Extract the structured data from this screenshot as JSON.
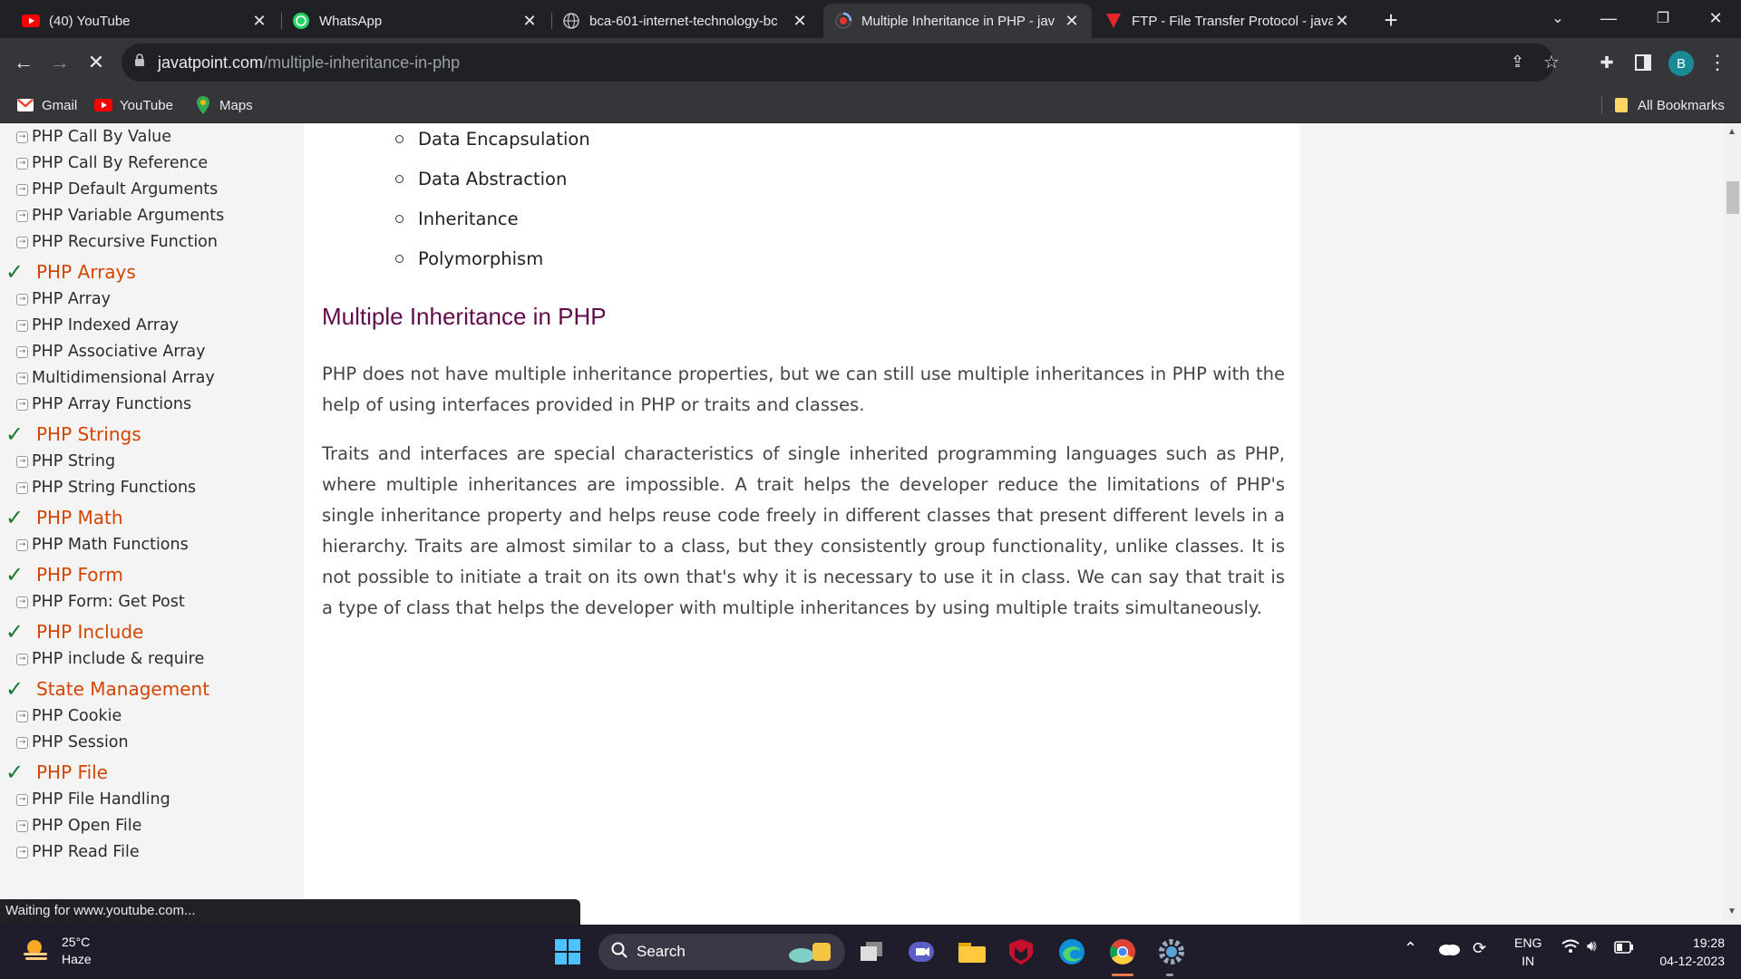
{
  "browser": {
    "tabs": [
      {
        "title": "(40) YouTube",
        "icon": "youtube-icon"
      },
      {
        "title": "WhatsApp",
        "icon": "whatsapp-icon"
      },
      {
        "title": "bca-601-internet-technology-bc",
        "icon": "globe-icon"
      },
      {
        "title": "Multiple Inheritance in PHP - jav",
        "icon": "loading-icon",
        "active": true
      },
      {
        "title": "FTP - File Transfer Protocol - java",
        "icon": "javatpoint-icon"
      }
    ],
    "url_domain": "javatpoint.com",
    "url_path": "/multiple-inheritance-in-php",
    "profile_initial": "B",
    "bookmarks": [
      "Gmail",
      "YouTube",
      "Maps"
    ],
    "all_bookmarks": "All Bookmarks"
  },
  "sidebar": {
    "sections": [
      {
        "type": "item",
        "label": "PHP Call By Value"
      },
      {
        "type": "item",
        "label": "PHP Call By Reference"
      },
      {
        "type": "item",
        "label": "PHP Default Arguments"
      },
      {
        "type": "item",
        "label": "PHP Variable Arguments"
      },
      {
        "type": "item",
        "label": "PHP Recursive Function"
      },
      {
        "type": "head",
        "label": "PHP Arrays"
      },
      {
        "type": "item",
        "label": "PHP Array"
      },
      {
        "type": "item",
        "label": "PHP Indexed Array"
      },
      {
        "type": "item",
        "label": "PHP Associative Array"
      },
      {
        "type": "item",
        "label": "Multidimensional Array"
      },
      {
        "type": "item",
        "label": "PHP Array Functions"
      },
      {
        "type": "head",
        "label": "PHP Strings"
      },
      {
        "type": "item",
        "label": "PHP String"
      },
      {
        "type": "item",
        "label": "PHP String Functions"
      },
      {
        "type": "head",
        "label": "PHP Math"
      },
      {
        "type": "item",
        "label": "PHP Math Functions"
      },
      {
        "type": "head",
        "label": "PHP Form"
      },
      {
        "type": "item",
        "label": "PHP Form: Get Post"
      },
      {
        "type": "head",
        "label": "PHP Include"
      },
      {
        "type": "item",
        "label": "PHP include & require"
      },
      {
        "type": "head",
        "label": "State Management"
      },
      {
        "type": "item",
        "label": "PHP Cookie"
      },
      {
        "type": "item",
        "label": "PHP Session"
      },
      {
        "type": "head",
        "label": "PHP File"
      },
      {
        "type": "item",
        "label": "PHP File Handling"
      },
      {
        "type": "item",
        "label": "PHP Open File"
      },
      {
        "type": "item",
        "label": "PHP Read File"
      }
    ]
  },
  "content": {
    "list": [
      "Data Encapsulation",
      "Data Abstraction",
      "Inheritance",
      "Polymorphism"
    ],
    "heading": "Multiple Inheritance in PHP",
    "para1": "PHP does not have multiple inheritance properties, but we can still use multiple inheritances in PHP with the help of using interfaces provided in PHP or traits and classes.",
    "para2": "Traits and interfaces are special characteristics of single inherited programming languages such as PHP, where multiple inheritances are impossible. A trait helps the developer reduce the limitations of PHP's single inheritance property and helps reuse code freely in different classes that present different levels in a hierarchy. Traits are almost similar to a class, but they consistently group functionality, unlike classes. It is not possible to initiate a trait on its own that's why it is necessary to use it in class. We can say that trait is a type of class that helps the developer with multiple inheritances by using multiple traits simultaneously."
  },
  "status_text": "Waiting for www.youtube.com...",
  "taskbar": {
    "temperature": "25°C",
    "weather": "Haze",
    "search_label": "Search",
    "lang": "ENG",
    "region": "IN",
    "time": "19:28",
    "date": "04-12-2023"
  },
  "colors": {
    "heading": "#610b4b",
    "sidebar_head": "#d44400",
    "check": "#1a7a2e"
  }
}
